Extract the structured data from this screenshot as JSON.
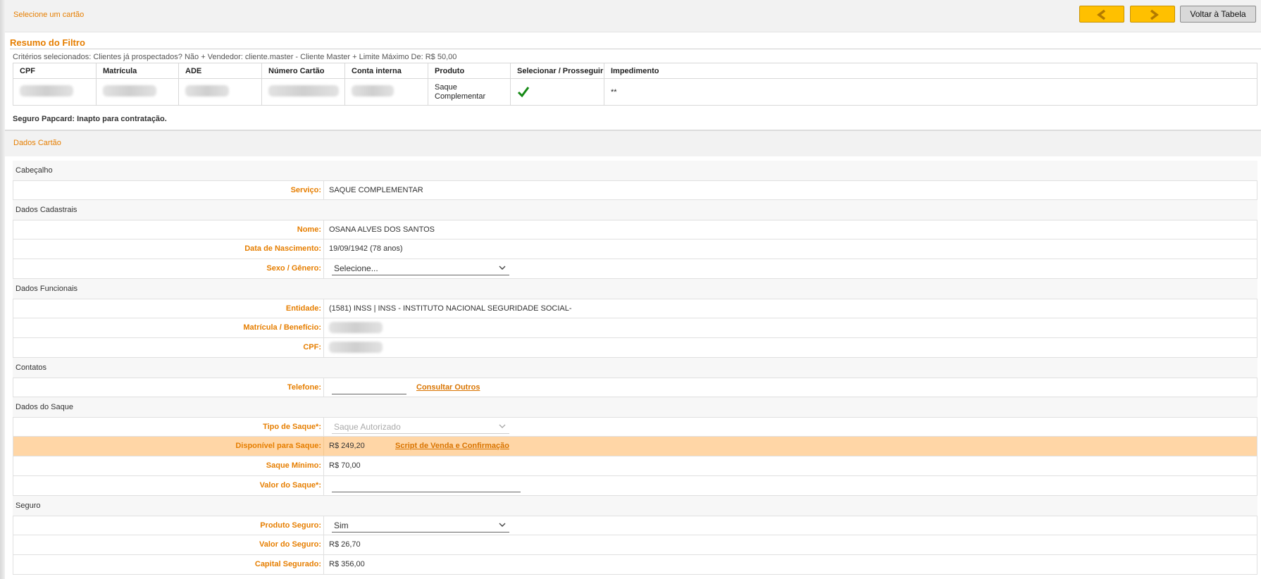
{
  "header": {
    "select_card_title": "Selecione um cartão",
    "back_button": "Voltar à Tabela",
    "prev_icon": "chevron-left-icon",
    "next_icon": "chevron-right-icon",
    "accent_color": "#ffc000"
  },
  "resumo": {
    "title": "Resumo do Filtro",
    "criteria": "Critérios selecionados: Clientes já prospectados? Não + Vendedor: cliente.master - Cliente Master + Limite Máximo De: R$ 50,00",
    "columns": [
      "CPF",
      "Matrícula",
      "ADE",
      "Número Cartão",
      "Conta interna",
      "Produto",
      "Selecionar / Prosseguir",
      "Impedimento"
    ],
    "row": {
      "produto": "Saque Complementar",
      "impedimento": "**"
    }
  },
  "seguro_papcard": "Seguro Papcard: Inapto para contratação.",
  "dados_cartao_title": "Dados Cartão",
  "sections": {
    "cabecalho": {
      "title": "Cabeçalho",
      "servico_label": "Serviço:",
      "servico_value": "SAQUE COMPLEMENTAR"
    },
    "cadastrais": {
      "title": "Dados Cadastrais",
      "nome_label": "Nome:",
      "nome_value": "OSANA ALVES DOS SANTOS",
      "nascimento_label": "Data de Nascimento:",
      "nascimento_value": "19/09/1942 (78 anos)",
      "sexo_label": "Sexo / Gênero:",
      "sexo_value": "Selecione..."
    },
    "funcionais": {
      "title": "Dados Funcionais",
      "entidade_label": "Entidade:",
      "entidade_value": "(1581) INSS | INSS - INSTITUTO NACIONAL SEGURIDADE SOCIAL-",
      "matricula_label": "Matrícula / Benefício:",
      "cpf_label": "CPF:"
    },
    "contatos": {
      "title": "Contatos",
      "telefone_label": "Telefone:",
      "consultar_link": "Consultar Outros"
    },
    "saque": {
      "title": "Dados do Saque",
      "tipo_label": "Tipo de Saque*:",
      "tipo_value": "Saque Autorizado",
      "disponivel_label": "Disponível para Saque:",
      "disponivel_value": "R$ 249,20",
      "script_link": "Script de Venda e Confirmação",
      "minimo_label": "Saque Mínimo:",
      "minimo_value": "R$ 70,00",
      "valor_label": "Valor do Saque*:"
    },
    "seguro": {
      "title": "Seguro",
      "produto_label": "Produto Seguro:",
      "produto_value": "Sim",
      "valor_label": "Valor do Seguro:",
      "valor_value": "R$ 26,70",
      "capital_label": "Capital Segurado:",
      "capital_value": "R$ 356,00"
    }
  }
}
